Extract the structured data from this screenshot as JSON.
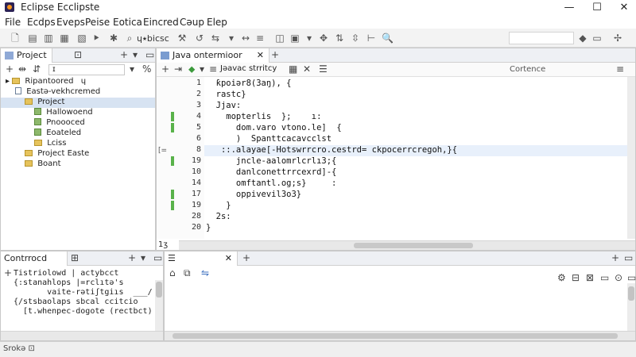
{
  "window": {
    "title": "Eclipse  Ecclipste",
    "minimize_glyph": "—",
    "maximize_glyph": "☐",
    "close_glyph": "✕"
  },
  "menu": [
    "File",
    "Ecdps",
    "Eveps",
    "Peise",
    "Eotica",
    "Eincred",
    "Cəup",
    "Elep"
  ],
  "toolbar": {
    "label": "ɥ⭑bicsc",
    "icons": [
      "new-file-icon",
      "open-icon",
      "save-icon",
      "save-all-icon",
      "build-icon",
      "run-icon",
      "debug-icon",
      "search-icon",
      "perspective-icon",
      "pin-icon"
    ]
  },
  "project_panel": {
    "tab_label": "Project",
    "filter_text": "ɪ",
    "tree": [
      {
        "label": "Ripantoored",
        "suffix": "ɥ",
        "icon": "folder",
        "selected": false
      },
      {
        "label": "Eastə-vekhcremed",
        "icon": "file",
        "selected": false
      },
      {
        "label": "Project",
        "icon": "folder",
        "selected": true
      },
      {
        "label": "Hallowoend",
        "icon": "pkg",
        "selected": false
      },
      {
        "label": "Pnoooced",
        "icon": "pkg",
        "selected": false
      },
      {
        "label": "Eoateled",
        "icon": "pkg",
        "selected": false
      },
      {
        "label": "Lciss",
        "icon": "folder",
        "selected": false
      },
      {
        "label": "Project Easte",
        "icon": "folder",
        "selected": false
      },
      {
        "label": "Boant",
        "icon": "folder",
        "selected": false
      }
    ]
  },
  "editor": {
    "tab_label": "Java ontermioor",
    "breadcrumb": "Jəavac strritcy",
    "right_label": "Cortence",
    "line_numbers": [
      "1",
      "2",
      "3",
      "4",
      "5",
      "6",
      "8",
      "19",
      "10",
      "14",
      "17",
      "19",
      "28",
      "20"
    ],
    "code": [
      "  ƙpoiər8(3aŋ), {",
      "  rastc}",
      "  Jjav:",
      "    mopterlis  };    ı:",
      "      dom.varo vtono.le]  {",
      "      )  Spanttcacavcclst",
      "   ::.alayae[-Hotswrrcro.cestrd= ckpocerrcregoh,}{",
      "      jncle-aalomrlcrlı3;{",
      "      danlconettrrcexrd]-{",
      "      omftantl.og;s}     :",
      "      oppivevil3o3}",
      "    }",
      "  2s:",
      "}"
    ],
    "active_line": "8",
    "bottom_left_num": "1ʒ"
  },
  "console_panel": {
    "tab_label": "Contrrocd",
    "lines": [
      "Tistriolowd | actybcct",
      "{:stanahlops |=rclıtə's",
      "       vaite-rətiʃtgiıs  ___/ros",
      "{/stsbaolaps sbcal ccitcio",
      "  [t.whenpec-dogote (rectbct)"
    ]
  },
  "output_panel": {
    "tab_label": ""
  },
  "status": {
    "text": "Srokə  ⊡"
  },
  "colors": {
    "accent": "#3b6fbf",
    "change_bar": "#59b24a",
    "selection": "#d7e3f2"
  }
}
